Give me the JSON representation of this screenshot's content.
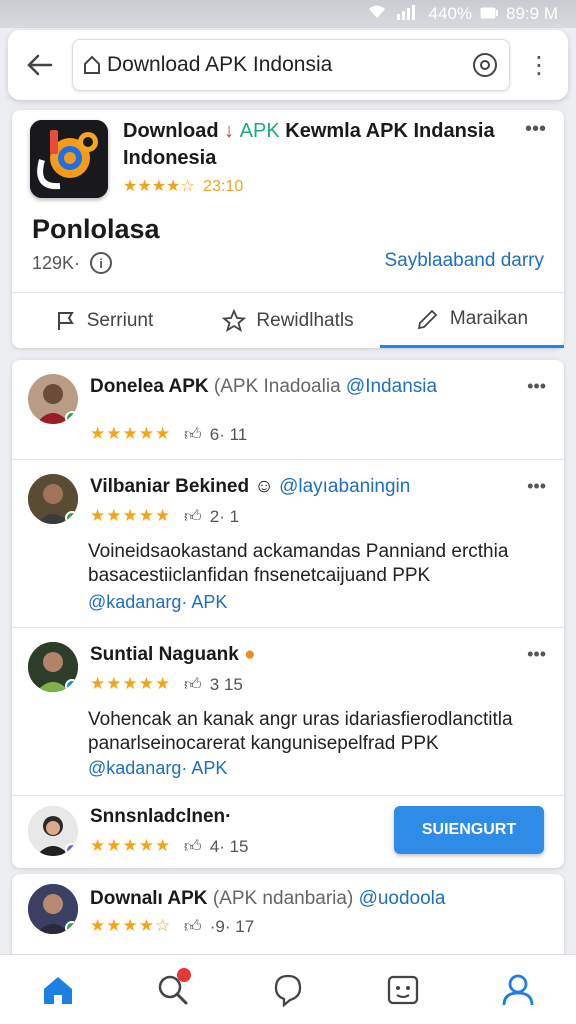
{
  "status_bar": {
    "wifi": "wifi-icon",
    "battery": "440%",
    "time": "89:9 M"
  },
  "top_bar": {
    "url": "Download APK Indonsia"
  },
  "app": {
    "title_part1": "Download",
    "title_accent": "APK",
    "title_part2": "Kewmla APK Indansia Indonesia",
    "stars": "★★★★☆",
    "rating": "23:10",
    "name": "Ponlolasa",
    "count": "129K·",
    "link": "Sayblaaband darry"
  },
  "tabs": [
    {
      "label": "Serriunt",
      "icon": "flag-icon"
    },
    {
      "label": "Rewidlhatls",
      "icon": "star-icon"
    },
    {
      "label": "Maraikan",
      "icon": "edit-icon"
    }
  ],
  "reviews": [
    {
      "name": "Donelea APK",
      "meta": "(APK Inadoalia",
      "handle": "@Indansia",
      "stars": "★★★★★",
      "likes": "6· 11"
    },
    {
      "name": "Vilbaniar Bekined",
      "meta": "",
      "handle": "@layıabaningin",
      "stars": "★★★★★",
      "likes": "2· 1",
      "text": "Voineidsaokastand ackamandas Panniand ercthia basacestiiclanfidan fnsenetcaijuand PPK",
      "tag": "@kadanarg· APK"
    },
    {
      "name": "Suntial Naguank",
      "meta": "",
      "handle": "",
      "stars": "★★★★★",
      "likes": "3 15",
      "text": "Vohencak an kanak angr uras idariasfierodlanctitla panarlseinocarerat kangunisepelfrad PPK",
      "tag": "@kadanarg· APK"
    },
    {
      "name": "Snnsnladclnen·",
      "meta": "",
      "handle": "",
      "stars": "★★★★★",
      "likes": "4· 15"
    }
  ],
  "subscribe_label": "SUIENGURT",
  "last_review": {
    "name": "Downalı APK",
    "meta": "(APK ndanbaria)",
    "handle": "@uodoola",
    "stars": "★★★★☆",
    "likes": "·9· 17"
  },
  "nav": [
    "home-icon",
    "search-icon",
    "chat-icon",
    "game-icon",
    "profile-icon"
  ]
}
